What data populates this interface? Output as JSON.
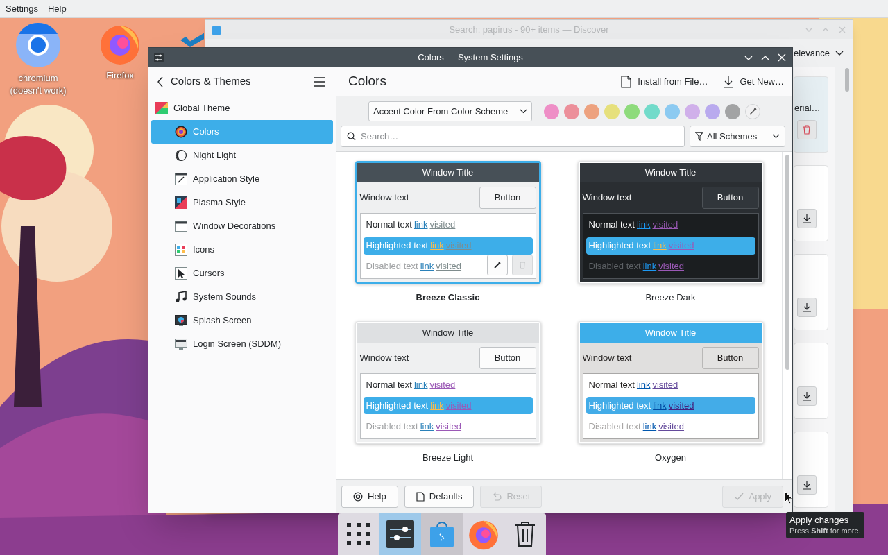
{
  "menubar": [
    {
      "label": "Settings"
    },
    {
      "label": "Help"
    }
  ],
  "desktop_icons": [
    {
      "label": "chromium (doesn't work)"
    },
    {
      "label": "Firefox"
    }
  ],
  "discover_window": {
    "title": "Search: papirus - 90+ items — Discover",
    "sort_label": "elevance",
    "items": [
      {
        "kind": "installed",
        "title": "erial…"
      },
      {
        "kind": "available"
      },
      {
        "kind": "available"
      },
      {
        "kind": "available"
      },
      {
        "kind": "available"
      }
    ]
  },
  "settings_window": {
    "title": "Colors — System Settings",
    "sidebar": {
      "header": "Colors & Themes",
      "items": [
        {
          "label": "Global Theme",
          "selected": false,
          "children": [
            {
              "label": "Colors",
              "selected": true
            },
            {
              "label": "Night Light",
              "selected": false
            },
            {
              "label": "Application Style",
              "selected": false
            },
            {
              "label": "Plasma Style",
              "selected": false
            },
            {
              "label": "Window Decorations",
              "selected": false
            },
            {
              "label": "Icons",
              "selected": false
            },
            {
              "label": "Cursors",
              "selected": false
            },
            {
              "label": "System Sounds",
              "selected": false
            },
            {
              "label": "Splash Screen",
              "selected": false
            },
            {
              "label": "Login Screen (SDDM)",
              "selected": false
            }
          ]
        }
      ]
    },
    "page_title": "Colors",
    "actions": [
      {
        "label": "Install from File…"
      },
      {
        "label": "Get New…"
      }
    ],
    "accent_dropdown": "Accent Color From Color Scheme",
    "accent_colors": [
      {
        "color": "#ee8ec6"
      },
      {
        "color": "#ec8f9a"
      },
      {
        "color": "#eda27f"
      },
      {
        "color": "#e6e07c"
      },
      {
        "color": "#8edb7c"
      },
      {
        "color": "#72dbca"
      },
      {
        "color": "#8ccaf1"
      },
      {
        "color": "#d0b0ea"
      },
      {
        "color": "#b9aaee"
      },
      {
        "color": "#a2a3a4"
      }
    ],
    "search": {
      "placeholder": "Search…"
    },
    "filter": "All Schemes",
    "schemes": [
      {
        "name": "Breeze Classic",
        "kind": "classic",
        "selected": true,
        "window_title": "Window Title",
        "window_text": "Window text",
        "button": "Button",
        "rows": [
          {
            "kind": "normal",
            "text": "Normal text",
            "link": "link",
            "visited": "visited"
          },
          {
            "kind": "highlighted",
            "text": "Highlighted text",
            "link": "link",
            "visited": "visited"
          },
          {
            "kind": "disabled",
            "text": "Disabled text",
            "link": "link",
            "visited": "visited"
          }
        ]
      },
      {
        "name": "Breeze Dark",
        "kind": "dark",
        "selected": false,
        "window_title": "Window Title",
        "window_text": "Window text",
        "button": "Button",
        "rows": [
          {
            "kind": "normal",
            "text": "Normal text",
            "link": "link",
            "visited": "visited"
          },
          {
            "kind": "highlighted",
            "text": "Highlighted text",
            "link": "link",
            "visited": "visited"
          },
          {
            "kind": "disabled",
            "text": "Disabled text",
            "link": "link",
            "visited": "visited"
          }
        ]
      },
      {
        "name": "Breeze Light",
        "kind": "light",
        "selected": false,
        "window_title": "Window Title",
        "window_text": "Window text",
        "button": "Button",
        "rows": [
          {
            "kind": "normal",
            "text": "Normal text",
            "link": "link",
            "visited": "visited"
          },
          {
            "kind": "highlighted",
            "text": "Highlighted text",
            "link": "link",
            "visited": "visited"
          },
          {
            "kind": "disabled",
            "text": "Disabled text",
            "link": "link",
            "visited": "visited"
          }
        ]
      },
      {
        "name": "Oxygen",
        "kind": "oxygen",
        "selected": false,
        "window_title": "Window Title",
        "window_text": "Window text",
        "button": "Button",
        "rows": [
          {
            "kind": "normal",
            "text": "Normal text",
            "link": "link",
            "visited": "visited"
          },
          {
            "kind": "highlighted",
            "text": "Highlighted text",
            "link": "link",
            "visited": "visited"
          },
          {
            "kind": "disabled",
            "text": "Disabled text",
            "link": "link",
            "visited": "visited"
          }
        ]
      }
    ],
    "buttons": [
      {
        "kind": "help",
        "label": "Help",
        "disabled": false
      },
      {
        "kind": "defaults",
        "label": "Defaults",
        "disabled": false
      },
      {
        "kind": "reset",
        "label": "Reset",
        "disabled": true
      },
      {
        "kind": "apply",
        "label": "Apply",
        "disabled": true
      }
    ]
  },
  "tooltip": {
    "title": "Apply changes",
    "hint": "Press **Shift** for more."
  },
  "taskbar": [
    {
      "kind": "launcher",
      "selected": false,
      "open": false
    },
    {
      "kind": "settings",
      "selected": true,
      "open": true
    },
    {
      "kind": "discover",
      "selected": false,
      "open": true
    },
    {
      "kind": "firefox",
      "selected": false,
      "open": false
    },
    {
      "kind": "trash",
      "selected": false,
      "open": false
    }
  ]
}
